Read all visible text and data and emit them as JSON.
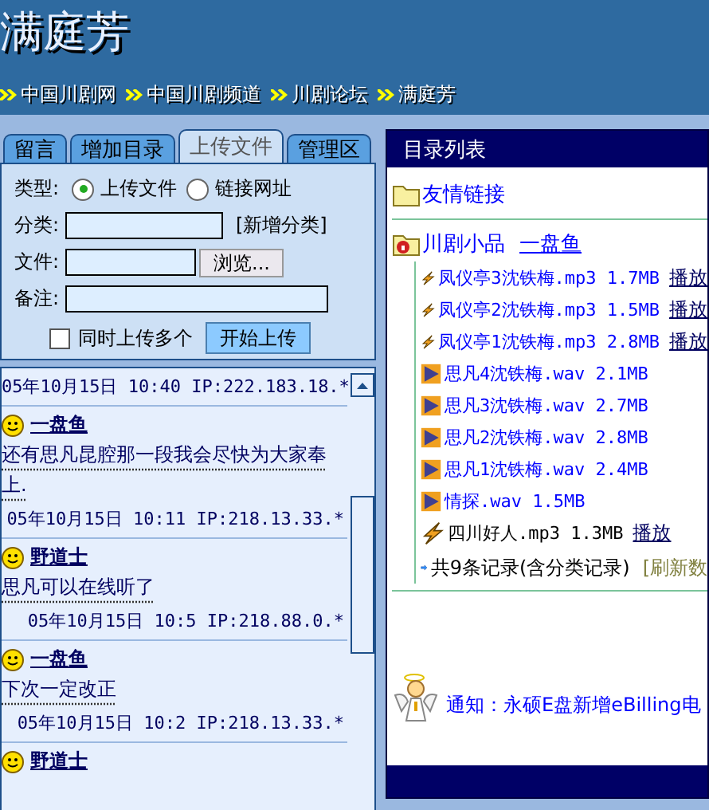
{
  "site_title": "满庭芳",
  "nav": [
    "中国川剧网",
    "中国川剧频道",
    "川剧论坛",
    "满庭芳"
  ],
  "tabs": [
    {
      "label": "留言",
      "selected": false
    },
    {
      "label": "增加目录",
      "selected": false
    },
    {
      "label": "上传文件",
      "selected": true
    },
    {
      "label": "管理区",
      "selected": false
    }
  ],
  "upload_form": {
    "type_label": "类型:",
    "types": [
      {
        "label": "上传文件",
        "selected": true
      },
      {
        "label": "链接网址",
        "selected": false
      }
    ],
    "category_label": "分类:",
    "new_category": "[新增分类]",
    "file_label": "文件:",
    "browse": "浏览...",
    "note_label": "备注:",
    "multi": {
      "label": "同时上传多个",
      "checked": false
    },
    "submit": "开始上传"
  },
  "messages": {
    "top_meta": "05年10月15日 10:40 IP:222.183.18.*",
    "posts": [
      {
        "author": "一盘鱼",
        "text": "还有思凡昆腔那一段我会尽快为大家奉上.",
        "meta": "05年10月15日 10:11 IP:218.13.33.*"
      },
      {
        "author": "野道士",
        "text": "思凡可以在线听了",
        "meta": "05年10月15日 10:5 IP:218.88.0.*"
      },
      {
        "author": "一盘鱼",
        "text": "下次一定改正",
        "meta": "05年10月15日 10:2 IP:218.13.33.*"
      },
      {
        "author": "野道士"
      }
    ]
  },
  "directory": {
    "title": "目录列表",
    "links_folder": "友情链接",
    "category": {
      "name": "川剧小品",
      "owner": "一盘鱼"
    },
    "files": [
      {
        "kind": "mp3",
        "name": "凤仪亭3沈铁梅.mp3 1.7MB",
        "play": "播放",
        "color": "#0000ff"
      },
      {
        "kind": "mp3",
        "name": "凤仪亭2沈铁梅.mp3 1.5MB",
        "play": "播放",
        "color": "#0000ff"
      },
      {
        "kind": "mp3",
        "name": "凤仪亭1沈铁梅.mp3 2.8MB",
        "play": "播放",
        "color": "#0000ff"
      },
      {
        "kind": "wav",
        "name": "思凡4沈铁梅.wav 2.1MB",
        "color": "#0000ff"
      },
      {
        "kind": "wav",
        "name": "思凡3沈铁梅.wav 2.7MB",
        "color": "#0000ff"
      },
      {
        "kind": "wav",
        "name": "思凡2沈铁梅.wav 2.8MB",
        "color": "#0000ff"
      },
      {
        "kind": "wav",
        "name": "思凡1沈铁梅.wav 2.4MB",
        "color": "#0000ff"
      },
      {
        "kind": "wav",
        "name": "情探.wav 1.5MB",
        "color": "#0000ff"
      },
      {
        "kind": "mp3",
        "name": "四川好人.mp3 1.3MB",
        "play": "播放",
        "color": "#000000"
      }
    ],
    "summary": "共9条记录(含分类记录)",
    "refresh": "[刷新数",
    "notice": "通知：永硕E盘新增eBilling电"
  }
}
